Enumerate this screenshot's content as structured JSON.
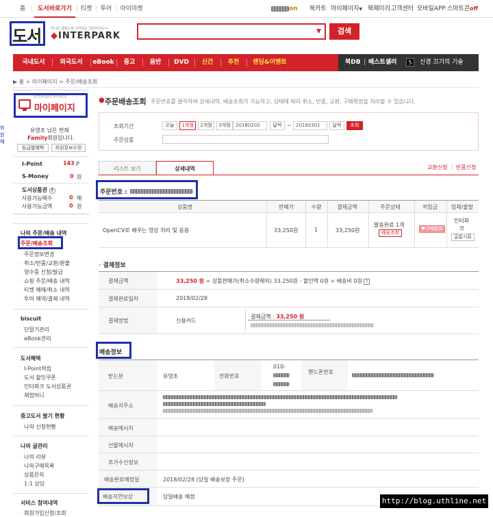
{
  "topbar": {
    "tabs": [
      "홈",
      "도서바로가기",
      "티켓",
      "투어",
      "아이마켓"
    ],
    "active_tab": "도서바로가기",
    "user_suffix": "on",
    "util": [
      "북카트",
      "마이페이지",
      "북패미리",
      "고객센터",
      "모바일APP",
      "스마트콘"
    ],
    "util_off": "off"
  },
  "header": {
    "logo": "도서",
    "brand_small": "하나의 행복으로 이어지는 인터파크도서",
    "brand_big_prefix": "◆",
    "brand_big": "INTERPARK",
    "search_placeholder": "",
    "search_button": "검색"
  },
  "gnb": {
    "menu": [
      "국내도서",
      "외국도서",
      "eBook",
      "중고",
      "음반",
      "DVD",
      "신간",
      "추천",
      "랜딩&이벤트"
    ],
    "dark": [
      "북DB",
      "베스트셀러"
    ],
    "promo_num": "5",
    "promo_text": "신경 끄기의 기술"
  },
  "breadcrumb": "▶ 홈 > 마이페이지 > 주문/배송조회",
  "left": {
    "mypage_sub": "INTERPARK MYPAGE",
    "mypage_title": "마이페이지",
    "user_greeting": "유영조 님은 현재",
    "grade_prefix": "Family",
    "grade_suffix": "회원입니다.",
    "btn_grade": "등급별혜택",
    "btn_info": "회원정보수정",
    "points": [
      {
        "label": "I-Point",
        "value": "143",
        "unit": "P"
      },
      {
        "label": "S-Money",
        "value": "0",
        "unit": "원"
      }
    ],
    "gift_title": "도서상품권",
    "gift_rows": [
      {
        "label": "사용가능매수",
        "value": "0",
        "unit": "매"
      },
      {
        "label": "사용가능금액",
        "value": "0",
        "unit": "원"
      }
    ],
    "left_edge": [
      "회",
      "원",
      "혜"
    ],
    "sections": [
      {
        "title": "나의 주문/배송 내역",
        "items": [
          "주문/배송조회",
          "주문정보변경",
          "취소/반품/교환/환불",
          "영수증 신청/발급",
          "쇼핑 주문/배송 내역",
          "티켓 예매/취소 내역",
          "투어 예약/결제 내역"
        ]
      },
      {
        "title": "biscuit",
        "items": [
          "단말기관리",
          "eBook관리"
        ]
      },
      {
        "title": "도서혜택",
        "items": [
          "I-Point적립",
          "도서 할인쿠폰",
          "인터파크 도서상품권",
          "체험머니"
        ]
      },
      {
        "title": "중고도서 팔기 현황",
        "items": [
          "나의 신청현황"
        ]
      },
      {
        "title": "나의 글관리",
        "items": [
          "나의 리뷰",
          "나의구매목록",
          "상품문의",
          "1:1 상담"
        ]
      },
      {
        "title": "서비스 참여내역",
        "items": [
          "회원가입신청/조회"
        ]
      }
    ]
  },
  "main": {
    "title": "주문배송조회",
    "desc": "· 주문번호를 클릭하여 상세내역, 배송조회가 가능하고, 상태에 따라 취소, 반품, 교환, 구매확정을 처리할 수 있습니다.",
    "period_label": "조회기간",
    "period_buttons": [
      "오늘",
      "1개월",
      "2개월",
      "3개월"
    ],
    "period_selected": "1개월",
    "date_from": "20180202",
    "date_to": "20180301",
    "cal_label": "달력",
    "tilde": "~",
    "query_btn": "조회",
    "product_label": "주문상품",
    "tabs": [
      "리스트 보기",
      "상세내역"
    ],
    "active_tab": "상세내역",
    "right_links": [
      "교환신청",
      "반품신청"
    ],
    "right_sep": "|",
    "order_no_label": "주문번호 :",
    "table_headers": [
      "상품명",
      "판매가",
      "수량",
      "결제금액",
      "주문상태",
      "적립금",
      "업체/출발"
    ],
    "order_row": {
      "name": "OpenCV로 배우는 영상 처리 및 응용",
      "price": "33,250원",
      "qty": "1",
      "paid": "33,250원",
      "status": "발송완료 1개",
      "status_btn": "배송조회",
      "reward_btn": "구매완료",
      "vendor": [
        "인터파",
        "크"
      ],
      "vendor_btn": "출발시류"
    },
    "payment": {
      "title": "결제정보",
      "rows": [
        {
          "label": "결제금액",
          "value_red": "33,250 원",
          "value_rest": "= 상품판매가(취소수량제외) 33,250원 - 할인액 0원 + 배송비 0원"
        },
        {
          "label": "결제완료일자",
          "value": "2018/02/28"
        },
        {
          "label": "결제방법",
          "value": "신용카드",
          "detail_label": "결제금액 :",
          "detail_value": "33,250 원"
        }
      ]
    },
    "shipping": {
      "title": "배송정보",
      "sender_label": "받는분",
      "sender": "유영조",
      "phone_label": "전화번호",
      "phone_prefix": "010-",
      "mobile_label": "핸드폰번호",
      "rows": [
        "배송지주소",
        "배송메시지",
        "선물메시지",
        "추가수신정보"
      ],
      "eta_label": "배송완료예정일",
      "eta": "2018/02/28 (당일 배송보장 주문)",
      "guarantee_label": "배송지연보상",
      "guarantee": "당일배송 예정"
    }
  },
  "watermark": "http://blog.uthline.net"
}
